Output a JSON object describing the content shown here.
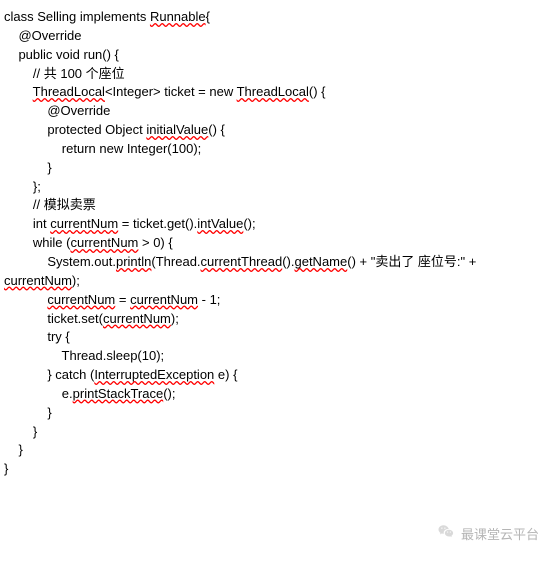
{
  "code": {
    "l1_a": "class Selling implements ",
    "l1_sq": "Runnable",
    "l1_b": "{",
    "blank": "",
    "l2": "    @Override",
    "l3": "    public void run() {",
    "l4": "        // 共 100 个座位",
    "l5_a": "        ",
    "l5_sq": "ThreadLocal",
    "l5_b": "<Integer> ticket = new ",
    "l5_sq2": "ThreadLocal",
    "l5_c": "() {",
    "l6": "            @Override",
    "l7_a": "            protected Object ",
    "l7_sq": "initialValue",
    "l7_b": "() {",
    "l8": "                return new Integer(100);",
    "l9": "            }",
    "l10": "        };",
    "l11": "        // 模拟卖票",
    "l12_a": "        int ",
    "l12_sq": "currentNum",
    "l12_b": " = ticket.get().",
    "l12_sq2": "intValue",
    "l12_c": "();",
    "l13_a": "        while (",
    "l13_sq": "currentNum",
    "l13_b": " > 0) {",
    "l14_a": "            System.out.",
    "l14_sq": "println",
    "l14_b": "(Thread.",
    "l14_sq2": "currentThread",
    "l14_c": "().",
    "l14_sq3": "getName",
    "l14_d": "() + \"卖出了 座位号:\" + ",
    "l15_sq": "currentNum",
    "l15_b": ");",
    "l16_a": "            ",
    "l16_sq": "currentNum",
    "l16_b": " = ",
    "l16_sq2": "currentNum",
    "l16_c": " - 1;",
    "l17_a": "            ticket.set(",
    "l17_sq": "currentNum",
    "l17_b": ");",
    "l18": "            try {",
    "l19": "                Thread.sleep(10);",
    "l20_a": "            } catch (",
    "l20_sq": "InterruptedException",
    "l20_b": " e) {",
    "l21_a": "                e.",
    "l21_sq": "printStackTrace",
    "l21_b": "();",
    "l22": "            }",
    "l23": "        }",
    "l24": "    }",
    "l25": "}"
  },
  "watermark": "最课堂云平台"
}
